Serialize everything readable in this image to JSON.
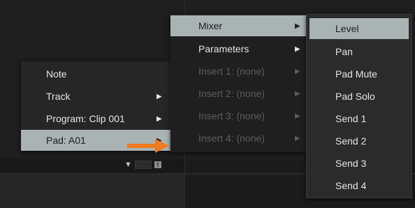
{
  "menu_pad": {
    "items": [
      {
        "label": "Note",
        "submenu": false,
        "state": "normal"
      },
      {
        "label": "Track",
        "submenu": true,
        "state": "normal"
      },
      {
        "label": "Program: Clip 001",
        "submenu": true,
        "state": "normal"
      },
      {
        "label": "Pad: A01",
        "submenu": true,
        "state": "highlighted"
      }
    ]
  },
  "menu_pad_sub": {
    "items": [
      {
        "label": "Mixer",
        "submenu": true,
        "state": "highlighted"
      },
      {
        "label": "Parameters",
        "submenu": true,
        "state": "normal"
      },
      {
        "label": "Insert 1: (none)",
        "submenu": true,
        "state": "disabled"
      },
      {
        "label": "Insert 2: (none)",
        "submenu": true,
        "state": "disabled"
      },
      {
        "label": "Insert 3: (none)",
        "submenu": true,
        "state": "disabled"
      },
      {
        "label": "Insert 4: (none)",
        "submenu": true,
        "state": "disabled"
      }
    ]
  },
  "menu_mixer": {
    "items": [
      {
        "label": "Level",
        "state": "highlighted"
      },
      {
        "label": "Pan",
        "state": "normal"
      },
      {
        "label": "Pad Mute",
        "state": "normal"
      },
      {
        "label": "Pad Solo",
        "state": "normal"
      },
      {
        "label": "Send 1",
        "state": "normal"
      },
      {
        "label": "Send 2",
        "state": "normal"
      },
      {
        "label": "Send 3",
        "state": "normal"
      },
      {
        "label": "Send 4",
        "state": "normal"
      }
    ]
  },
  "toolbar": {
    "icon_box_label": "!"
  },
  "colors": {
    "highlight": "#a9b3b4",
    "annotation_arrow": "#f07a1e",
    "disabled_text": "#5d5d5d"
  }
}
